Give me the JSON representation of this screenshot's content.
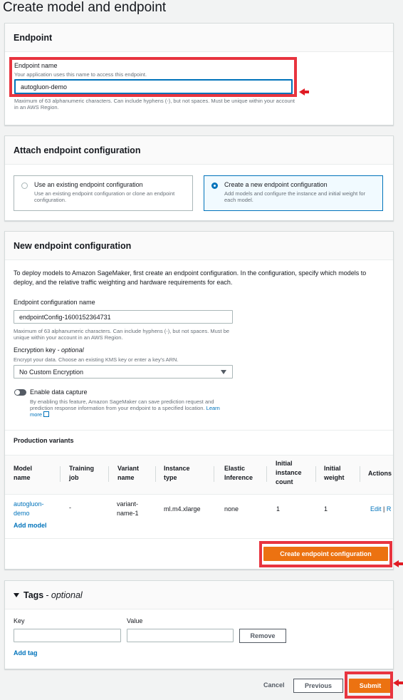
{
  "page": {
    "title": "Create model and endpoint"
  },
  "endpoint": {
    "header": "Endpoint",
    "name_label": "Endpoint name",
    "name_hint": "Your application uses this name to access this endpoint.",
    "name_value": "autogluon-demo",
    "name_constraint": "Maximum of 63 alphanumeric characters. Can include hyphens (-), but not spaces. Must be unique within your account in an AWS Region."
  },
  "attach": {
    "header": "Attach endpoint configuration",
    "options": [
      {
        "title": "Use an existing endpoint configuration",
        "desc": "Use an existing endpoint configuration or clone an endpoint configuration.",
        "selected": false
      },
      {
        "title": "Create a new endpoint configuration",
        "desc": "Add models and configure the instance and initial weight for each model.",
        "selected": true
      }
    ]
  },
  "new_config": {
    "header": "New endpoint configuration",
    "intro": "To deploy models to Amazon SageMaker, first create an endpoint configuration. In the configuration, specify which models to deploy, and the relative traffic weighting and hardware requirements for each.",
    "name_label": "Endpoint configuration name",
    "name_value": "endpointConfig-1600152364731",
    "name_constraint": "Maximum of 63 alphanumeric characters. Can include hyphens (-), but not spaces. Must be unique within your account in an AWS Region.",
    "encryption_label": "Encryption key",
    "encryption_optional": "- optional",
    "encryption_hint": "Encrypt your data. Choose an existing KMS key or enter a key's ARN.",
    "encryption_value": "No Custom Encryption",
    "capture_label": "Enable data capture",
    "capture_desc": "By enabling this feature, Amazon SageMaker can save prediction request and prediction response information from your endpoint to a specified location.",
    "learn_more": "Learn more",
    "variants_header": "Production variants",
    "columns": [
      "Model name",
      "Training job",
      "Variant name",
      "Instance type",
      "Elastic Inference",
      "Initial instance count",
      "Initial weight",
      "Actions"
    ],
    "row": {
      "model": "autogluon-demo",
      "training_job": "-",
      "variant": "variant-name-1",
      "instance": "ml.m4.xlarge",
      "elastic": "none",
      "count": "1",
      "weight": "1",
      "edit": "Edit",
      "sep": "|",
      "more": "R"
    },
    "add_model": "Add model",
    "create_button": "Create endpoint configuration"
  },
  "tags": {
    "header": "Tags",
    "optional": "- optional",
    "key_label": "Key",
    "value_label": "Value",
    "remove_button": "Remove",
    "add_tag": "Add tag"
  },
  "footer": {
    "cancel": "Cancel",
    "previous": "Previous",
    "submit": "Submit"
  },
  "colors": {
    "accent": "#ec7211",
    "link": "#0073bb",
    "highlight": "#e8343f"
  }
}
